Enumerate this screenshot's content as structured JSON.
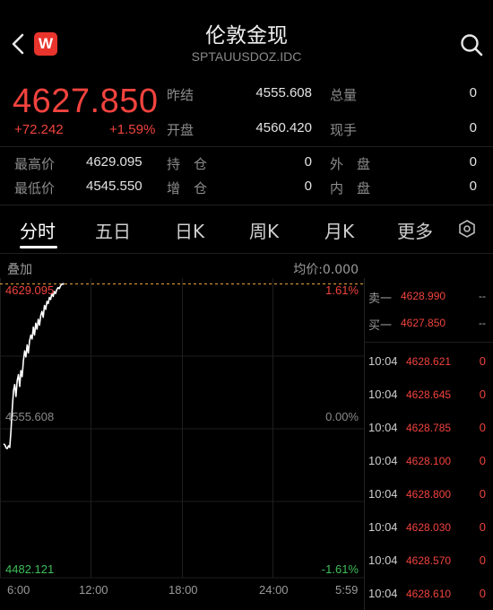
{
  "header": {
    "title": "伦敦金现",
    "code": "SPTAUUSDOZ.IDC",
    "logo_letter": "W",
    "back_icon": "chevron-left-icon",
    "search_icon": "search-icon"
  },
  "quote": {
    "price": "4627.850",
    "change": "+72.242",
    "change_pct": "+1.59%",
    "color_up": "#f2433e",
    "color_down": "#3fbf5a"
  },
  "stats": [
    {
      "label": "昨结",
      "value": "4555.608"
    },
    {
      "label": "总量",
      "value": "0"
    },
    {
      "label": "开盘",
      "value": "4560.420"
    },
    {
      "label": "现手",
      "value": "0"
    },
    {
      "label": "最高价",
      "value": "4629.095"
    },
    {
      "label": "持　仓",
      "value": "0"
    },
    {
      "label": "外　盘",
      "value": "0"
    },
    {
      "label": "最低价",
      "value": "4545.550"
    },
    {
      "label": "增　仓",
      "value": "0"
    },
    {
      "label": "内　盘",
      "value": "0"
    }
  ],
  "tabs": [
    "分时",
    "五日",
    "日K",
    "周K",
    "月K",
    "更多"
  ],
  "active_tab": "分时",
  "chart_labels": {
    "overlay": "叠加",
    "avg": "均价:0.000",
    "y_top": "4629.095",
    "y_mid": "4555.608",
    "y_bot": "4482.121",
    "pct_top": "1.61%",
    "pct_mid": "0.00%",
    "pct_bot": "-1.61%",
    "x_ticks": [
      "6:00",
      "12:00",
      "18:00",
      "24:00",
      "5:59"
    ]
  },
  "chart_data": {
    "type": "line",
    "title": "",
    "xlabel": "",
    "ylabel": "",
    "ylim": [
      4482.121,
      4629.095
    ],
    "reference": 4555.608,
    "x": [
      "6:00",
      "6:05",
      "6:10",
      "6:15",
      "6:20",
      "6:25",
      "6:30",
      "6:35",
      "6:40",
      "6:45",
      "6:50",
      "6:55",
      "7:00",
      "7:05",
      "7:10",
      "7:15",
      "7:20",
      "7:25",
      "7:30",
      "7:35",
      "7:40",
      "7:45",
      "7:50",
      "7:55",
      "8:00",
      "8:05",
      "8:10",
      "8:15",
      "8:20",
      "8:25",
      "8:30",
      "8:35",
      "8:40",
      "8:45",
      "8:50",
      "8:55",
      "9:00",
      "9:05",
      "9:10",
      "9:15",
      "9:20",
      "9:25",
      "9:30",
      "9:35",
      "9:40",
      "9:45",
      "9:50",
      "9:55",
      "10:00",
      "10:04"
    ],
    "values": [
      4548.0,
      4547.5,
      4546.0,
      4545.6,
      4547.0,
      4546.2,
      4555.0,
      4566.0,
      4575.0,
      4578.0,
      4572.0,
      4580.0,
      4583.0,
      4577.0,
      4585.0,
      4582.0,
      4590.0,
      4595.0,
      4592.0,
      4598.0,
      4594.0,
      4600.0,
      4603.0,
      4601.0,
      4607.0,
      4603.0,
      4609.0,
      4606.0,
      4611.0,
      4608.0,
      4613.0,
      4615.0,
      4612.0,
      4618.0,
      4616.0,
      4620.0,
      4619.0,
      4622.0,
      4621.0,
      4624.0,
      4622.5,
      4625.0,
      4624.0,
      4626.0,
      4627.0,
      4626.5,
      4628.0,
      4628.7,
      4629.0,
      4628.6
    ],
    "grid": true
  },
  "order_book": [
    {
      "label": "卖一",
      "price": "4628.990",
      "volume": "--"
    },
    {
      "label": "买一",
      "price": "4627.850",
      "volume": "--"
    }
  ],
  "trades": [
    {
      "time": "10:04",
      "price": "4628.621",
      "volume": "0"
    },
    {
      "time": "10:04",
      "price": "4628.645",
      "volume": "0"
    },
    {
      "time": "10:04",
      "price": "4628.785",
      "volume": "0"
    },
    {
      "time": "10:04",
      "price": "4628.100",
      "volume": "0"
    },
    {
      "time": "10:04",
      "price": "4628.800",
      "volume": "0"
    },
    {
      "time": "10:04",
      "price": "4628.030",
      "volume": "0"
    },
    {
      "time": "10:04",
      "price": "4628.570",
      "volume": "0"
    },
    {
      "time": "10:04",
      "price": "4628.610",
      "volume": "0"
    }
  ]
}
